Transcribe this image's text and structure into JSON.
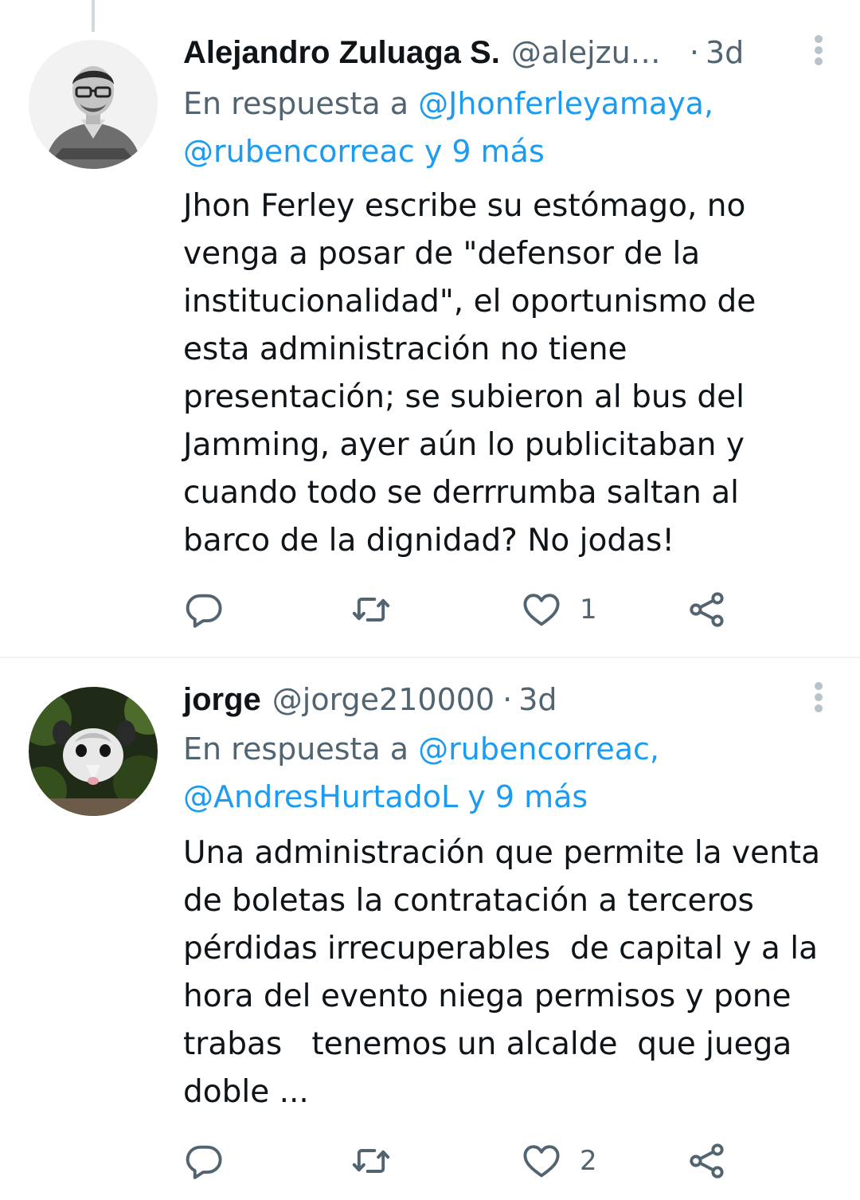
{
  "tweets": [
    {
      "display_name": "Alejandro Zuluaga S.",
      "handle": "@alejzul…",
      "time": "3d",
      "reply_prefix": "En respuesta a",
      "reply_mention_1": "@Jhonferleyamaya,",
      "reply_mention_2": "@rubencorreac",
      "reply_more": "y 9 más",
      "text": "Jhon Ferley escribe su estómago, no\nvenga a posar de \"defensor de la\ninstitucionalidad\", el oportunismo de\nesta administración no tiene\npresentación; se subieron al bus del\nJamming, ayer aún lo publicitaban y\ncuando todo se derrrumba saltan al\nbarco de la dignidad? No jodas!",
      "likes": "1"
    },
    {
      "display_name": "jorge",
      "handle": "@jorge210000",
      "time": "3d",
      "reply_prefix": "En respuesta a",
      "reply_mention_1": "@rubencorreac,",
      "reply_mention_2": "@AndresHurtadoL",
      "reply_more": "y 9 más",
      "text": "Una administración que permite la venta\nde boletas la contratación a terceros\npérdidas irrecuperables  de capital y a la\nhora del evento niega permisos y pone\ntrabas   tenemos un alcalde  que juega\ndoble ...",
      "likes": "2"
    }
  ],
  "icons": {
    "reply": "reply-icon",
    "retweet": "retweet-icon",
    "like": "heart-icon",
    "share": "share-icon",
    "more": "more-options-icon"
  },
  "colors": {
    "link": "#1d9bf0",
    "secondary_text": "#536471",
    "primary_text": "#0f1419",
    "divider": "#eff3f4"
  }
}
